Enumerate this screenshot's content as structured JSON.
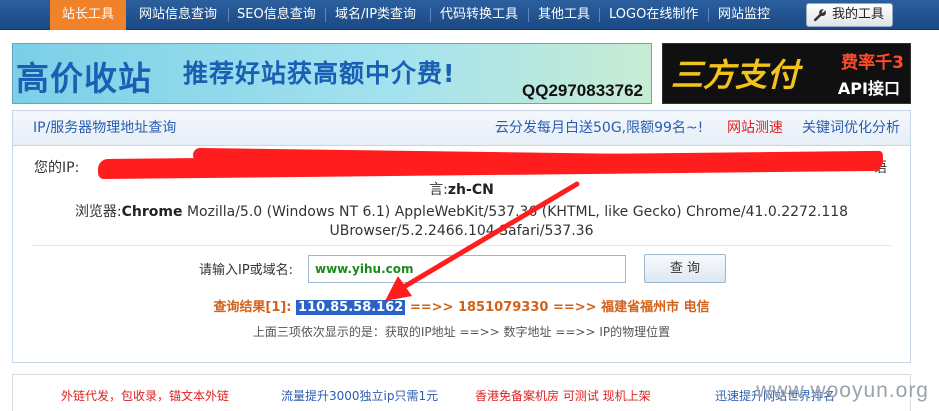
{
  "nav": {
    "items": [
      "站长工具",
      "网站信息查询",
      "SEO信息查询",
      "域名/IP类查询",
      "代码转换工具",
      "其他工具",
      "LOGO在线制作",
      "网站监控"
    ],
    "tool_button": "我的工具",
    "tool_icon": "wrench-icon"
  },
  "banners": {
    "left_title": "高价收站",
    "left_slogan": "推荐好站获高额中介费!",
    "left_qq": "QQ2970833762",
    "right_brand": "三方支付",
    "right_rate": "费率千3",
    "right_api": "API接口"
  },
  "panel": {
    "title": "IP/服务器物理地址查询",
    "promo": "云分发每月白送50G,限额99名~!",
    "link_speed": "网站测速",
    "link_keyword": "关键词优化分析"
  },
  "info": {
    "ip_label": "您的IP:",
    "ip_suffix_char": "语",
    "lang_line": "言:",
    "lang_value": "zh-CN",
    "browser_label": "浏览器:",
    "browser_name": "Chrome",
    "ua_line1": "Mozilla/5.0 (Windows NT 6.1) AppleWebKit/537.36 (KHTML, like Gecko) Chrome/41.0.2272.118",
    "ua_line2": "UBrowser/5.2.2466.104 Safari/537.36"
  },
  "query": {
    "label": "请输入IP或域名:",
    "input_value": "www.yihu.com",
    "button": "查 询"
  },
  "result": {
    "prefix": "查询结果[1]:",
    "ip": "110.85.58.162",
    "arrow1": "==>>",
    "number": "1851079330",
    "arrow2": "==>>",
    "location": "福建省福州市 电信",
    "hint": "上面三项依次显示的是：获取的IP地址 ==>> 数字地址 ==>> IP的物理位置"
  },
  "ads": {
    "a1": "外链代发，包收录，锚文本外链",
    "a2": "流量提升3000独立ip只需1元",
    "a3": "香港免备案机房 可测试 现机上架",
    "a4": "迅速提升网站世界排名"
  },
  "watermark": "www.wooyun.org",
  "colors": {
    "nav_bg": "#1b4a85",
    "nav_active": "#f0822a",
    "redaction": "#ff1d1d",
    "result_text": "#d2611a",
    "highlight": "#2a63c7"
  }
}
